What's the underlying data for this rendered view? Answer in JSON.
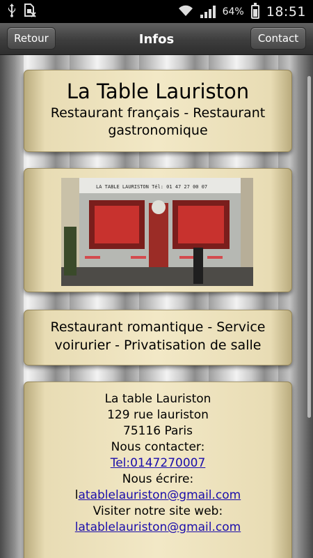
{
  "status_bar": {
    "battery_percent": "64%",
    "time": "18:51",
    "icons": [
      "usb-icon",
      "sim-off-icon",
      "wifi-icon",
      "signal-icon",
      "battery-charging-icon"
    ]
  },
  "header": {
    "back_label": "Retour",
    "title": "Infos",
    "contact_label": "Contact"
  },
  "card_name": {
    "name": "La Table Lauriston",
    "type": "Restaurant français - Restaurant gastronomique"
  },
  "card_photo": {
    "sign_text": "LA TABLE LAURISTON    Tél: 01 47 27 00 07"
  },
  "card_services": {
    "text": "Restaurant romantique - Service voirurier - Privatisation de salle"
  },
  "card_contact": {
    "line1": "La table Lauriston",
    "line2": "129 rue lauriston",
    "line3": "75116 Paris",
    "contact_heading": "Nous contacter:",
    "phone_link": "Tel:0147270007",
    "email_heading": "Nous écrire:",
    "email_prefix": "l",
    "email_link": "atablelauriston@gmail.com",
    "website_heading": "Visiter notre site web:",
    "website_link": "latablelauriston@gmail.com"
  },
  "colors": {
    "card": "#f2e8c6",
    "link": "#1a0dab",
    "header": "#3d3d3d"
  }
}
